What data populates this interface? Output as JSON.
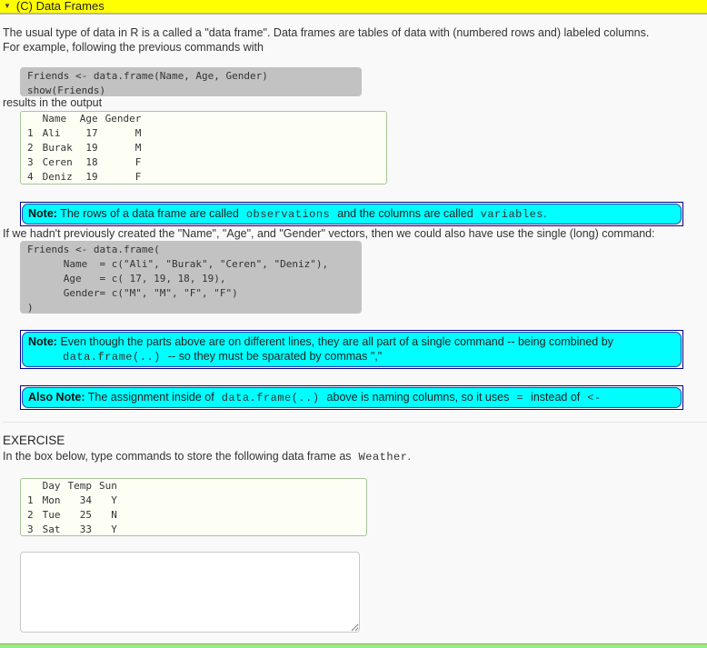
{
  "header": {
    "toggle_icon": "triangle-down",
    "title": "(C) Data Frames"
  },
  "intro": {
    "line1": "The usual type of data in R is a called a \"data frame\". Data frames are tables of data with (numbered rows and) labeled columns.",
    "line2": "For example, following the previous commands with"
  },
  "code1": "Friends <- data.frame(Name, Age, Gender)\nshow(Friends)",
  "results_label": "results in the output",
  "friends_table": {
    "headers": [
      "",
      "Name",
      "Age",
      "Gender"
    ],
    "rows": [
      [
        "1",
        "Ali",
        "17",
        "M"
      ],
      [
        "2",
        "Burak",
        "19",
        "M"
      ],
      [
        "3",
        "Ceren",
        "18",
        "F"
      ],
      [
        "4",
        "Deniz",
        "19",
        "F"
      ]
    ]
  },
  "note1": {
    "label": "Note:",
    "text_a": "The rows of a data frame are called",
    "code_a": "observations",
    "text_b": "and the columns are called",
    "code_b": "variables",
    "text_c": "."
  },
  "long_cmd_text": "If we hadn't previously created the \"Name\", \"Age\", and \"Gender\" vectors, then we could also have use the single (long) command:",
  "code2": "Friends <- data.frame(\n      Name  = c(\"Ali\", \"Burak\", \"Ceren\", \"Deniz\"),\n      Age   = c( 17, 19, 18, 19),\n      Gender= c(\"M\", \"M\", \"F\", \"F\")\n)",
  "note2": {
    "label": "Note:",
    "text_a": "Even though the parts above are on different lines, they are all part of a single command -- being combined by",
    "code_a": "data.frame(..)",
    "text_b": "-- so they must be sparated by commas \",\""
  },
  "note3": {
    "label": "Also Note:",
    "text_a": "The assignment inside of",
    "code_a": "data.frame(..)",
    "text_b": "above is naming columns, so it uses",
    "code_b": "=",
    "text_c": "instead of",
    "code_c": "<-"
  },
  "exercise": {
    "title": "EXERCISE",
    "instruction": "In the box below, type commands to store the following data frame as",
    "instruction_code": "Weather",
    "instruction_end": ".",
    "answer_value": ""
  },
  "weather_table": {
    "headers": [
      "",
      "Day",
      "Temp",
      "Sun"
    ],
    "rows": [
      [
        "1",
        "Mon",
        "34",
        "Y"
      ],
      [
        "2",
        "Tue",
        "25",
        "N"
      ],
      [
        "3",
        "Sat",
        "33",
        "Y"
      ]
    ]
  },
  "colors": {
    "header_bg": "#ffff00",
    "note_bg": "#00ffff",
    "note_border": "#00008b",
    "code_bg": "#c2c2c2",
    "output_bg": "#fdfff5",
    "bottom_bar": "#90ee90"
  }
}
